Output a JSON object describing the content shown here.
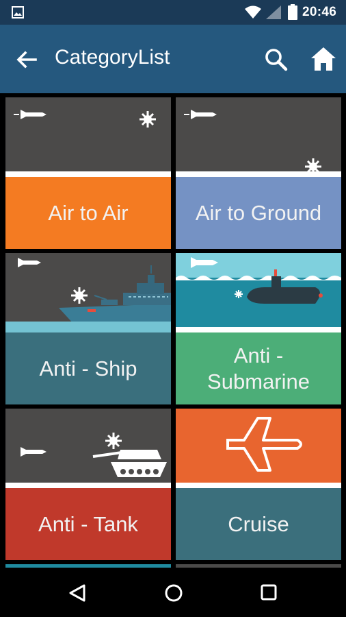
{
  "status_bar": {
    "time": "20:46",
    "icons": [
      "image-notification-icon",
      "wifi-icon",
      "signal-icon",
      "battery-icon"
    ]
  },
  "app_bar": {
    "title": "CategoryList",
    "icons": [
      "back-arrow-icon",
      "search-icon",
      "home-icon"
    ]
  },
  "categories": [
    {
      "label": "Air to Air",
      "color": "#f47b22",
      "art": "missile-vs-air-target"
    },
    {
      "label": "Air to Ground",
      "color": "#7592c4",
      "art": "missile-vs-ground-target"
    },
    {
      "label": "Anti - Ship",
      "color": "#3a6f7d",
      "art": "missile-vs-ship"
    },
    {
      "label": "Anti - Submarine",
      "color": "#4cae78",
      "art": "torpedo-vs-submarine"
    },
    {
      "label": "Anti - Tank",
      "color": "#c0392b",
      "art": "missile-vs-tank"
    },
    {
      "label": "Cruise",
      "color": "#3b6f7c",
      "art": "cruise-missile"
    }
  ],
  "nav_bar": {
    "icons": [
      "nav-back-icon",
      "nav-home-icon",
      "nav-recents-icon"
    ]
  }
}
